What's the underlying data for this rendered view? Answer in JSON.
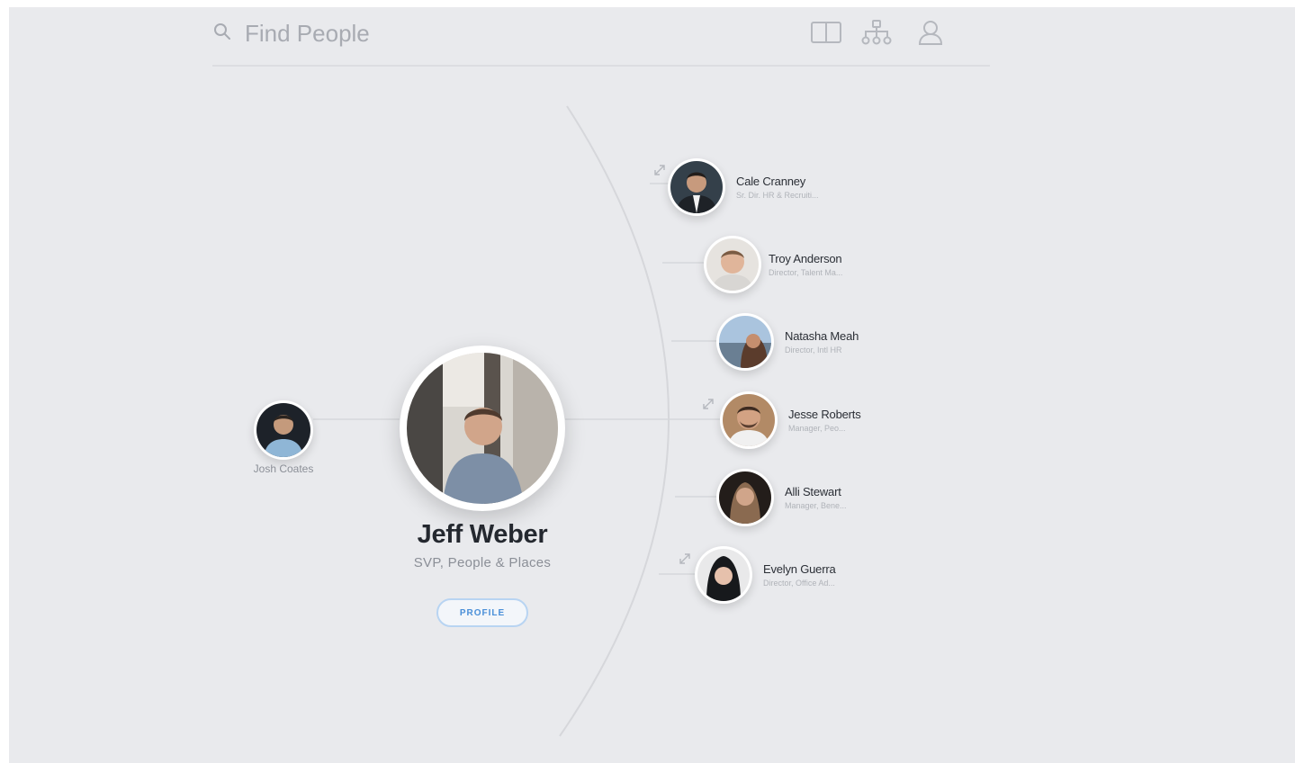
{
  "search": {
    "placeholder": "Find People"
  },
  "toolbar": {
    "icons": [
      "columns-view-icon",
      "org-chart-icon",
      "person-icon"
    ]
  },
  "focus_person": {
    "name": "Jeff Weber",
    "title": "SVP, People & Places",
    "profile_button": "PROFILE"
  },
  "manager": {
    "name": "Josh Coates"
  },
  "reports": [
    {
      "name": "Cale Cranney",
      "title": "Sr. Dir. HR & Recruiti..."
    },
    {
      "name": "Troy Anderson",
      "title": "Director, Talent Ma..."
    },
    {
      "name": "Natasha Meah",
      "title": "Director, Intl HR"
    },
    {
      "name": "Jesse Roberts",
      "title": "Manager, Peo..."
    },
    {
      "name": "Alli Stewart",
      "title": "Manager, Bene..."
    },
    {
      "name": "Evelyn Guerra",
      "title": "Director, Office Ad..."
    }
  ],
  "colors": {
    "background": "#e9eaed",
    "accent": "#4a8fd8",
    "arc": "#d9dadd"
  }
}
